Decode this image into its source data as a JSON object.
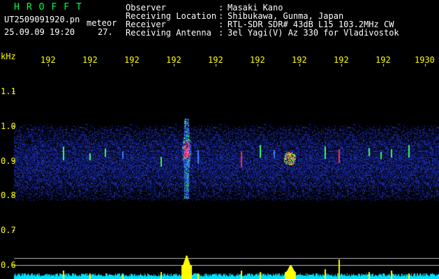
{
  "header": {
    "app_title": "HROFFT",
    "filename": "UT2509091920.pn",
    "file_tag": "meteor",
    "datetime": "25.09.09 19:20",
    "number": "27."
  },
  "station_info": [
    {
      "label": "Observer",
      "value": "Masaki Kano"
    },
    {
      "label": "Receiving Location",
      "value": "Shibukawa, Gunma, Japan"
    },
    {
      "label": "Receiver",
      "value": "RTL-SDR SDR# 43dB L15 103.2MHz CW"
    },
    {
      "label": "Receiving Antenna",
      "value": "3el Yagi(V) Az 330 for Vladivostok"
    }
  ],
  "time_axis": {
    "labels": [
      "192",
      "192",
      "192",
      "192",
      "192",
      "192",
      "192",
      "192",
      "192",
      "1930"
    ]
  },
  "freq_axis": {
    "unit": "kHz",
    "labels": [
      "1.1",
      "1.0",
      "0.9",
      "0.8",
      "0.7",
      "0.6"
    ]
  },
  "colors": {
    "background": "#000000",
    "text_white": "#ffffff",
    "text_yellow": "#ffff00",
    "title_green": "#00ff44",
    "noise_blue": "#1a2aa0",
    "echo_red": "#ff2a6a",
    "echo_green": "#33ff66",
    "baseline_cyan": "#00e0ff",
    "peak_yellow": "#ffff00"
  }
}
